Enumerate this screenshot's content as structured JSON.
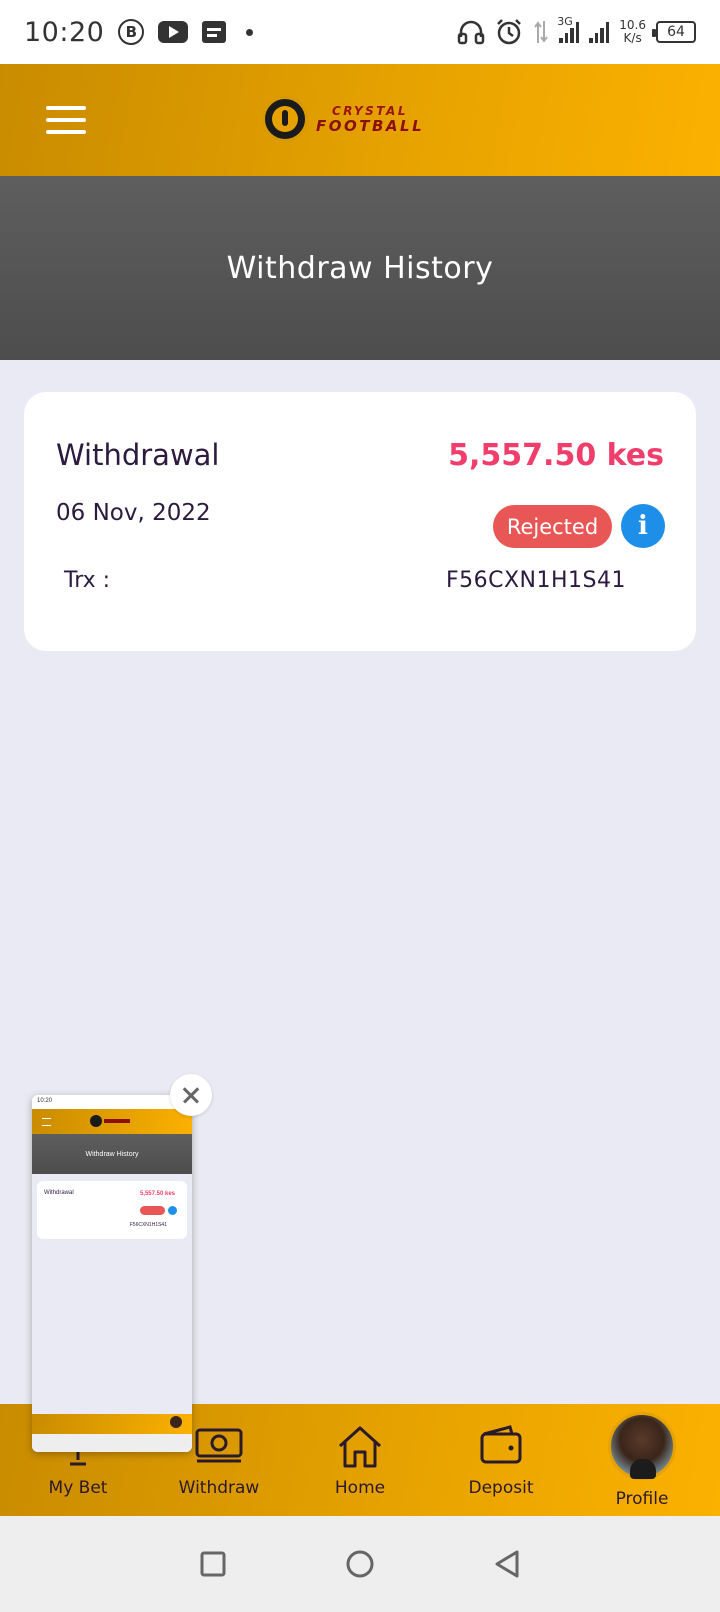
{
  "status_bar": {
    "time": "10:20",
    "network_type": "3G",
    "net_speed_value": "10.6",
    "net_speed_unit": "K/s",
    "battery": "64",
    "icons": [
      "b-notification-icon",
      "youtube-icon",
      "message-icon",
      "dot-icon",
      "headphones-icon",
      "alarm-icon",
      "data-arrows-icon",
      "signal-icon",
      "signal-icon-2",
      "battery-icon"
    ]
  },
  "header": {
    "logo_line1": "CRYSTAL",
    "logo_line2": "FOOTBALL",
    "menu_icon": "hamburger-icon"
  },
  "page": {
    "title": "Withdraw History"
  },
  "transactions": [
    {
      "type": "Withdrawal",
      "amount": "5,557.50 kes",
      "date": "06 Nov, 2022",
      "status": "Rejected",
      "trx_label": "Trx :",
      "trx_id": "F56CXN1H1S41"
    }
  ],
  "bottom_nav": {
    "items": [
      {
        "label": "My Bet",
        "icon": "trophy-icon"
      },
      {
        "label": "Withdraw",
        "icon": "money-icon"
      },
      {
        "label": "Home",
        "icon": "home-icon"
      },
      {
        "label": "Deposit",
        "icon": "wallet-icon"
      },
      {
        "label": "Profile",
        "icon": "avatar"
      }
    ]
  },
  "preview": {
    "title": "Withdraw History",
    "type": "Withdrawal",
    "amount": "5,557.50 kes",
    "trx_id": "F56CXN1H1S41",
    "time": "10:20"
  },
  "colors": {
    "accent_gold": "#e6a200",
    "amount_pink": "#ef3e6c",
    "rejected_red": "#e95656",
    "info_blue": "#1e8fe8",
    "banner_gray": "#555555",
    "background": "#e9eaf3"
  }
}
